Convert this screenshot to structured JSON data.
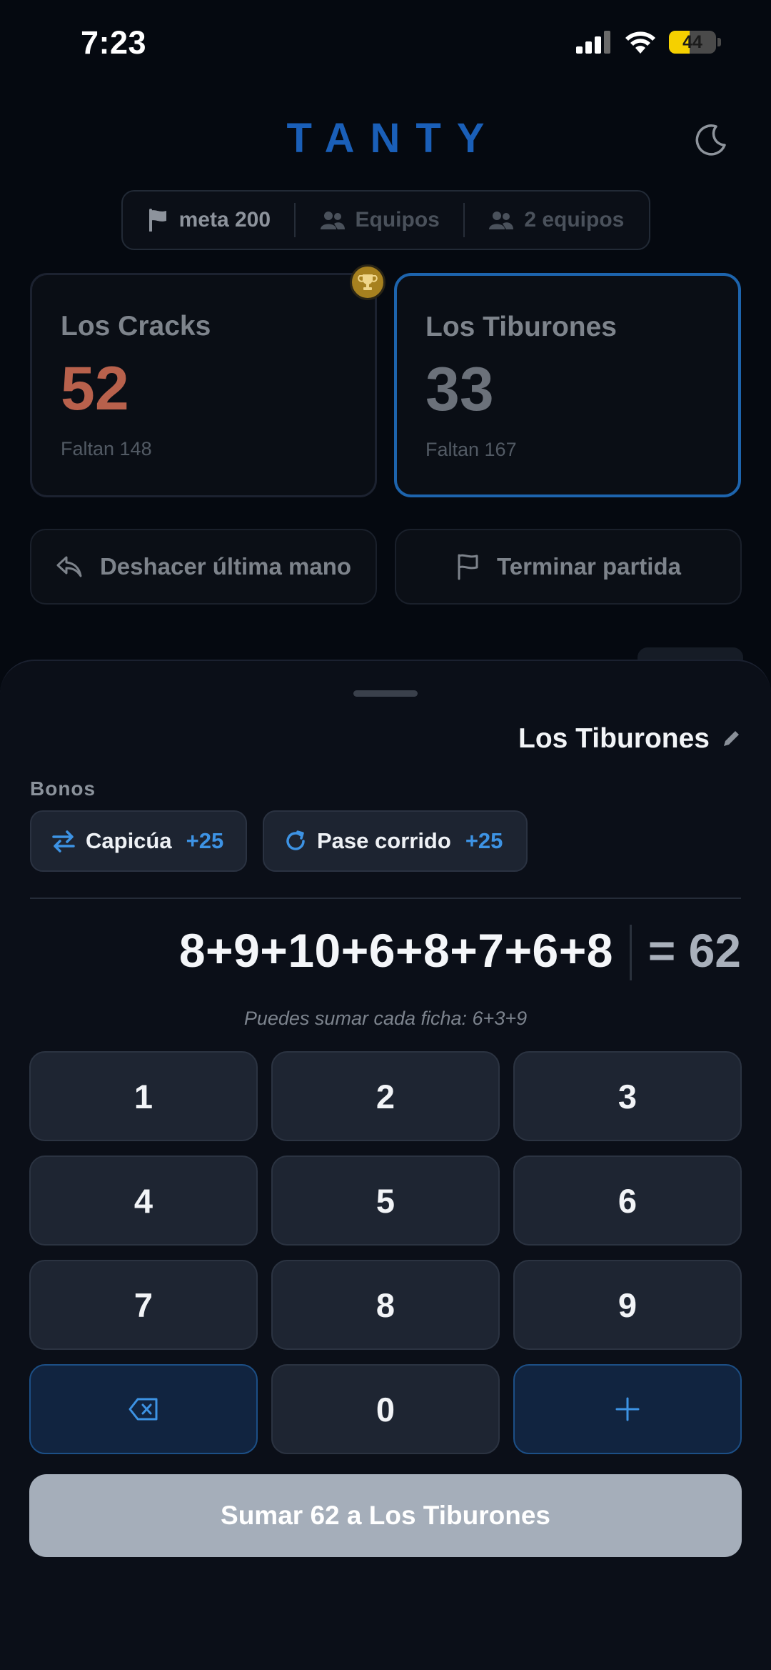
{
  "status_bar": {
    "time": "7:23",
    "battery_level": "44",
    "battery_fraction": 0.44,
    "icons": [
      "signal-icon",
      "wifi-icon",
      "battery-icon"
    ]
  },
  "header": {
    "logo": "TANTY",
    "theme_icon": "moon-icon"
  },
  "meta_bar": {
    "goal": "meta 200",
    "mode": "Equipos",
    "teams": "2 equipos"
  },
  "teams": [
    {
      "name": "Los Cracks",
      "score": "52",
      "remaining": "Faltan 148",
      "score_color": "#b8614c",
      "leader": true
    },
    {
      "name": "Los Tiburones",
      "score": "33",
      "remaining": "Faltan 167",
      "score_color": "#6b717a",
      "selected": true
    }
  ],
  "actions": {
    "undo": "Deshacer última mano",
    "finish": "Terminar partida"
  },
  "sheet": {
    "team": "Los Tiburones",
    "bonos_label": "Bonos",
    "bonuses": [
      {
        "label": "Capicúa",
        "points": "+25"
      },
      {
        "label": "Pase corrido",
        "points": "+25"
      }
    ],
    "expression": "8+9+10+6+8+7+6+8",
    "total": "= 62",
    "hint": "Puedes sumar cada ficha: 6+3+9",
    "keys": [
      "1",
      "2",
      "3",
      "4",
      "5",
      "6",
      "7",
      "8",
      "9",
      "0"
    ],
    "submit": "Sumar 62 a Los Tiburones"
  },
  "colors": {
    "accent": "#1d64ad",
    "bonus_points": "#3d93e4",
    "background": "#050910"
  }
}
